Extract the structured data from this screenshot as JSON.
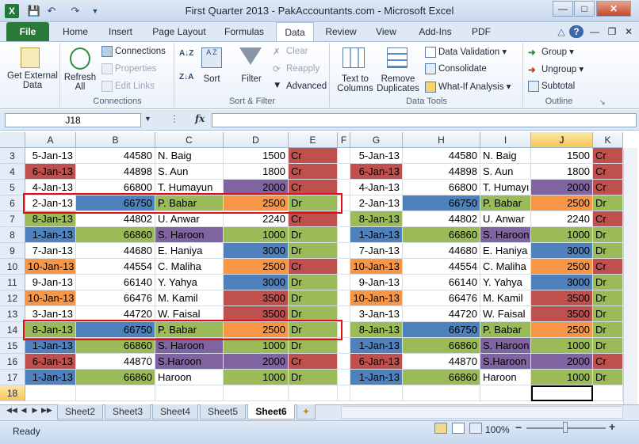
{
  "window": {
    "title": "First Quarter 2013 - PakAccountants.com - Microsoft Excel",
    "app_icon": "X"
  },
  "tabs": [
    "File",
    "Home",
    "Insert",
    "Page Layout",
    "Formulas",
    "Data",
    "Review",
    "View",
    "Add-Ins",
    "PDF"
  ],
  "ribbon": {
    "get_external_data": "Get External Data",
    "refresh_all": "Refresh All",
    "connections": "Connections",
    "properties": "Properties",
    "edit_links": "Edit Links",
    "group_connections": "Connections",
    "sort": "Sort",
    "filter": "Filter",
    "clear": "Clear",
    "reapply": "Reapply",
    "advanced": "Advanced",
    "group_sort_filter": "Sort & Filter",
    "text_to_columns": "Text to Columns",
    "remove_duplicates": "Remove Duplicates",
    "data_validation": "Data Validation",
    "consolidate": "Consolidate",
    "what_if": "What-If Analysis",
    "group_data_tools": "Data Tools",
    "group": "Group",
    "ungroup": "Ungroup",
    "subtotal": "Subtotal",
    "group_outline": "Outline"
  },
  "formula_bar": {
    "name_box": "J18",
    "fx": "fx",
    "value": ""
  },
  "columns": [
    "A",
    "B",
    "C",
    "D",
    "E",
    "F",
    "G",
    "H",
    "I",
    "J",
    "K"
  ],
  "rows": [
    {
      "n": "3",
      "date": "5-Jan-13",
      "amt": "44580",
      "name": "N. Baig",
      "val": "1500",
      "type": "Cr",
      "c": [
        "",
        "",
        "",
        "",
        "red"
      ]
    },
    {
      "n": "4",
      "date": "6-Jan-13",
      "amt": "44898",
      "name": "S. Aun",
      "val": "1800",
      "type": "Cr",
      "c": [
        "red",
        "",
        "",
        "",
        "red"
      ]
    },
    {
      "n": "5",
      "date": "4-Jan-13",
      "amt": "66800",
      "name": "T. Humayun",
      "val": "2000",
      "type": "Cr",
      "c": [
        "",
        "",
        "",
        "purple",
        "red"
      ]
    },
    {
      "n": "6",
      "date": "2-Jan-13",
      "amt": "66750",
      "name": "P. Babar",
      "val": "2500",
      "type": "Dr",
      "c": [
        "",
        "blue",
        "green",
        "orange",
        "green"
      ]
    },
    {
      "n": "7",
      "date": "8-Jan-13",
      "amt": "44802",
      "name": "U. Anwar",
      "val": "2240",
      "type": "Cr",
      "c": [
        "green",
        "",
        "",
        "",
        "red"
      ]
    },
    {
      "n": "8",
      "date": "1-Jan-13",
      "amt": "66860",
      "name": "S. Haroon",
      "val": "1000",
      "type": "Dr",
      "c": [
        "blue",
        "green",
        "purple",
        "green",
        "green"
      ]
    },
    {
      "n": "9",
      "date": "7-Jan-13",
      "amt": "44680",
      "name": "E. Haniya",
      "val": "3000",
      "type": "Dr",
      "c": [
        "",
        "",
        "",
        "blue",
        "green"
      ]
    },
    {
      "n": "10",
      "date": "10-Jan-13",
      "amt": "44554",
      "name": "C. Maliha",
      "val": "2500",
      "type": "Cr",
      "c": [
        "orange",
        "",
        "",
        "orange",
        "red"
      ]
    },
    {
      "n": "11",
      "date": "9-Jan-13",
      "amt": "66140",
      "name": "Y. Yahya",
      "val": "3000",
      "type": "Dr",
      "c": [
        "",
        "",
        "",
        "blue",
        "green"
      ]
    },
    {
      "n": "12",
      "date": "10-Jan-13",
      "amt": "66476",
      "name": "M. Kamil",
      "val": "3500",
      "type": "Dr",
      "c": [
        "orange",
        "",
        "",
        "red",
        "green"
      ]
    },
    {
      "n": "13",
      "date": "3-Jan-13",
      "amt": "44720",
      "name": "W. Faisal",
      "val": "3500",
      "type": "Dr",
      "c": [
        "",
        "",
        "",
        "red",
        "green"
      ]
    },
    {
      "n": "14",
      "date": "8-Jan-13",
      "amt": "66750",
      "name": "P. Babar",
      "val": "2500",
      "type": "Dr",
      "c": [
        "green",
        "blue",
        "green",
        "orange",
        "green"
      ]
    },
    {
      "n": "15",
      "date": "1-Jan-13",
      "amt": "66860",
      "name": "S. Haroon",
      "val": "1000",
      "type": "Dr",
      "c": [
        "blue",
        "green",
        "purple",
        "green",
        "green"
      ]
    },
    {
      "n": "16",
      "date": "6-Jan-13",
      "amt": "44870",
      "name": "S.Haroon",
      "val": "2000",
      "type": "Cr",
      "c": [
        "red",
        "",
        "purple",
        "purple",
        "red"
      ]
    },
    {
      "n": "17",
      "date": "1-Jan-13",
      "amt": "66860",
      "name": "Haroon",
      "val": "1000",
      "type": "Dr",
      "c": [
        "blue",
        "green",
        "",
        "green",
        "green"
      ]
    },
    {
      "n": "18",
      "date": "",
      "amt": "",
      "name": "",
      "val": "",
      "type": "",
      "c": [
        "",
        "",
        "",
        "",
        ""
      ]
    }
  ],
  "right_name_overrides": {
    "5": "T. Humayı"
  },
  "colors": {
    "red": "#c0504d",
    "green": "#9bbb59",
    "blue": "#4f81bd",
    "orange": "#f79646",
    "purple": "#8064a2"
  },
  "sheets": [
    "Sheet2",
    "Sheet3",
    "Sheet4",
    "Sheet5",
    "Sheet6"
  ],
  "active_sheet": "Sheet6",
  "status": {
    "ready": "Ready",
    "zoom": "100%"
  }
}
